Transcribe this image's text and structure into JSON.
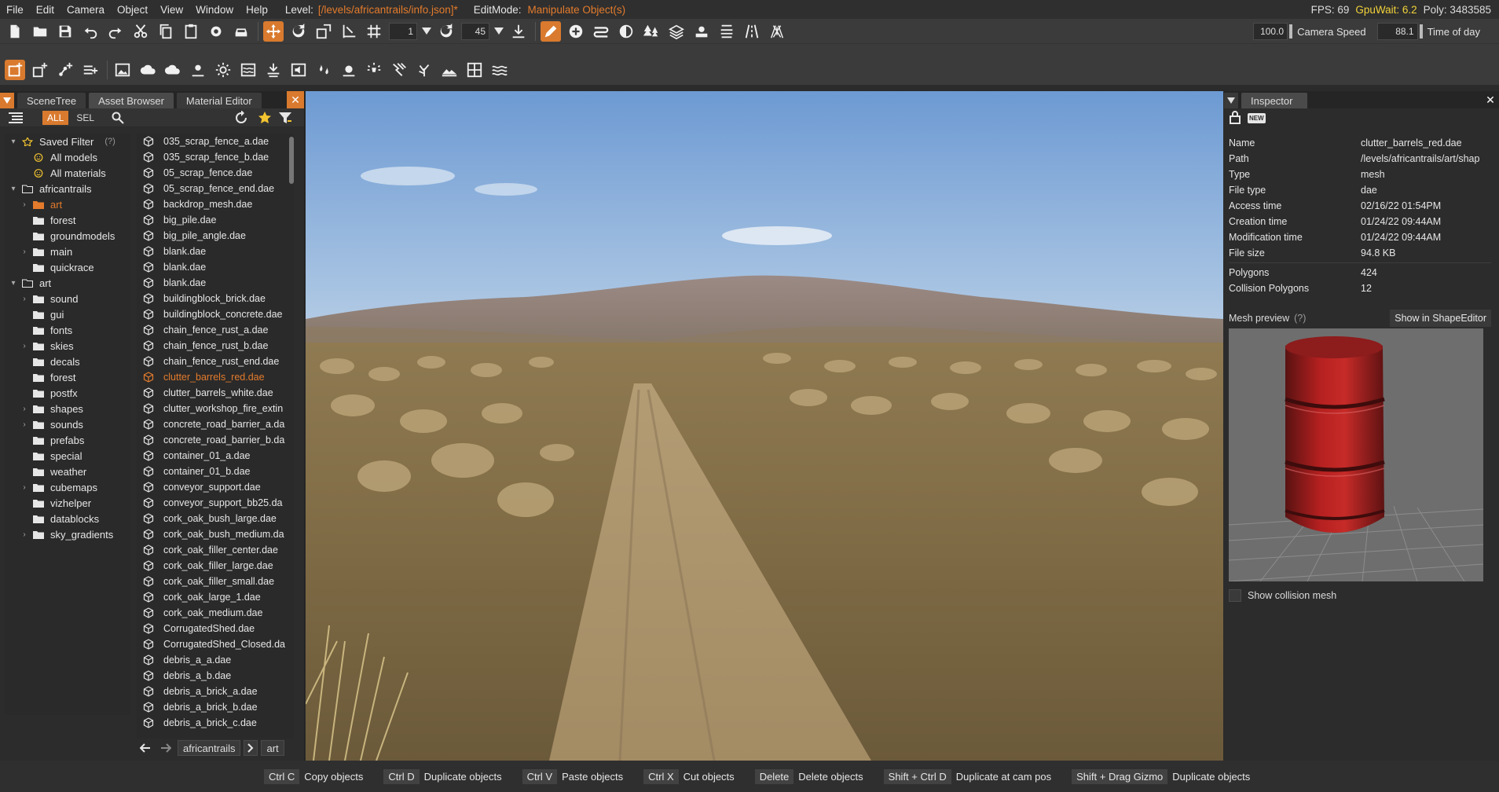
{
  "menubar": {
    "items": [
      "File",
      "Edit",
      "Camera",
      "Object",
      "View",
      "Window",
      "Help"
    ],
    "level_label": "Level:",
    "level_value": "[/levels/africantrails/info.json]*",
    "editmode_label": "EditMode:",
    "editmode_value": "Manipulate Object(s)",
    "fps": "FPS: 69",
    "gpuwait": "GpuWait: 6.2",
    "poly": "Poly: 3483585"
  },
  "toolbar1": {
    "grid_snap_value": "1",
    "rotate_snap_value": "45",
    "camera_speed_value": "100.0",
    "camera_speed_label": "Camera Speed",
    "time_of_day_value": "88.1",
    "time_of_day_label": "Time of day"
  },
  "left_panel": {
    "tabs": [
      "SceneTree",
      "Asset Browser",
      "Material Editor"
    ],
    "filter_all": "ALL",
    "filter_sel": "SEL",
    "tree": [
      {
        "label": "Saved Filter",
        "arrow": "v",
        "indent": 0,
        "icon": "star",
        "suffix": "(?)"
      },
      {
        "label": "All models",
        "arrow": "",
        "indent": 1,
        "icon": "smiley"
      },
      {
        "label": "All materials",
        "arrow": "",
        "indent": 1,
        "icon": "smiley"
      },
      {
        "label": "africantrails",
        "arrow": "v",
        "indent": 0,
        "icon": "folder-open"
      },
      {
        "label": "art",
        "arrow": ">",
        "indent": 1,
        "icon": "folder-orange",
        "highlight": true
      },
      {
        "label": "forest",
        "arrow": "",
        "indent": 1,
        "icon": "folder"
      },
      {
        "label": "groundmodels",
        "arrow": "",
        "indent": 1,
        "icon": "folder"
      },
      {
        "label": "main",
        "arrow": ">",
        "indent": 1,
        "icon": "folder"
      },
      {
        "label": "quickrace",
        "arrow": "",
        "indent": 1,
        "icon": "folder"
      },
      {
        "label": "art",
        "arrow": "v",
        "indent": 0,
        "icon": "folder-open"
      },
      {
        "label": "sound",
        "arrow": ">",
        "indent": 1,
        "icon": "folder"
      },
      {
        "label": "gui",
        "arrow": "",
        "indent": 1,
        "icon": "folder"
      },
      {
        "label": "fonts",
        "arrow": "",
        "indent": 1,
        "icon": "folder"
      },
      {
        "label": "skies",
        "arrow": ">",
        "indent": 1,
        "icon": "folder"
      },
      {
        "label": "decals",
        "arrow": "",
        "indent": 1,
        "icon": "folder"
      },
      {
        "label": "forest",
        "arrow": "",
        "indent": 1,
        "icon": "folder"
      },
      {
        "label": "postfx",
        "arrow": "",
        "indent": 1,
        "icon": "folder"
      },
      {
        "label": "shapes",
        "arrow": ">",
        "indent": 1,
        "icon": "folder"
      },
      {
        "label": "sounds",
        "arrow": ">",
        "indent": 1,
        "icon": "folder"
      },
      {
        "label": "prefabs",
        "arrow": "",
        "indent": 1,
        "icon": "folder"
      },
      {
        "label": "special",
        "arrow": "",
        "indent": 1,
        "icon": "folder"
      },
      {
        "label": "weather",
        "arrow": "",
        "indent": 1,
        "icon": "folder"
      },
      {
        "label": "cubemaps",
        "arrow": ">",
        "indent": 1,
        "icon": "folder"
      },
      {
        "label": "vizhelper",
        "arrow": "",
        "indent": 1,
        "icon": "folder"
      },
      {
        "label": "datablocks",
        "arrow": "",
        "indent": 1,
        "icon": "folder"
      },
      {
        "label": "sky_gradients",
        "arrow": ">",
        "indent": 1,
        "icon": "folder"
      }
    ],
    "files": [
      "035_scrap_fence_a.dae",
      "035_scrap_fence_b.dae",
      "05_scrap_fence.dae",
      "05_scrap_fence_end.dae",
      "backdrop_mesh.dae",
      "big_pile.dae",
      "big_pile_angle.dae",
      "blank.dae",
      "blank.dae",
      "blank.dae",
      "buildingblock_brick.dae",
      "buildingblock_concrete.dae",
      "chain_fence_rust_a.dae",
      "chain_fence_rust_b.dae",
      "chain_fence_rust_end.dae",
      "clutter_barrels_red.dae",
      "clutter_barrels_white.dae",
      "clutter_workshop_fire_extin",
      "concrete_road_barrier_a.da",
      "concrete_road_barrier_b.da",
      "container_01_a.dae",
      "container_01_b.dae",
      "conveyor_support.dae",
      "conveyor_support_bb25.da",
      "cork_oak_bush_large.dae",
      "cork_oak_bush_medium.da",
      "cork_oak_filler_center.dae",
      "cork_oak_filler_large.dae",
      "cork_oak_filler_small.dae",
      "cork_oak_large_1.dae",
      "cork_oak_medium.dae",
      "CorrugatedShed.dae",
      "CorrugatedShed_Closed.da",
      "debris_a_a.dae",
      "debris_a_b.dae",
      "debris_a_brick_a.dae",
      "debris_a_brick_b.dae",
      "debris_a_brick_c.dae"
    ],
    "selected_file": "clutter_barrels_red.dae",
    "path": [
      "africantrails",
      "art"
    ]
  },
  "inspector": {
    "tab": "Inspector",
    "props": [
      {
        "k": "Name",
        "v": "clutter_barrels_red.dae"
      },
      {
        "k": "Path",
        "v": "/levels/africantrails/art/shap"
      },
      {
        "k": "Type",
        "v": "mesh"
      },
      {
        "k": "File type",
        "v": "dae"
      },
      {
        "k": "Access time",
        "v": "02/16/22 01:54PM"
      },
      {
        "k": "Creation time",
        "v": "01/24/22 09:44AM"
      },
      {
        "k": "Modification time",
        "v": "01/24/22 09:44AM"
      },
      {
        "k": "File size",
        "v": "94.8 KB"
      }
    ],
    "props2": [
      {
        "k": "Polygons",
        "v": "424"
      },
      {
        "k": "Collision Polygons",
        "v": "12"
      }
    ],
    "mesh_preview_label": "Mesh preview",
    "mesh_preview_help": "(?)",
    "show_in_shapeeditor": "Show in ShapeEditor",
    "show_collision_mesh": "Show collision mesh",
    "new_badge": "NEW"
  },
  "statusbar": [
    {
      "key": "Ctrl C",
      "text": "Copy objects"
    },
    {
      "key": "Ctrl D",
      "text": "Duplicate objects"
    },
    {
      "key": "Ctrl V",
      "text": "Paste objects"
    },
    {
      "key": "Ctrl X",
      "text": "Cut objects"
    },
    {
      "key": "Delete",
      "text": "Delete objects"
    },
    {
      "key": "Shift + Ctrl D",
      "text": "Duplicate at cam pos"
    },
    {
      "key": "Shift + Drag Gizmo",
      "text": "Duplicate objects"
    }
  ],
  "colors": {
    "accent": "#d97a2e",
    "highlight_text": "#e37b2c",
    "gpu_text": "#f2d23a"
  }
}
